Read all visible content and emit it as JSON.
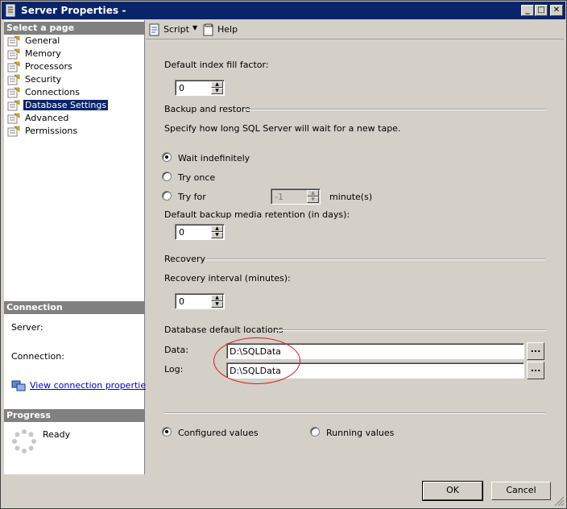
{
  "window": {
    "title": "Server Properties -"
  },
  "titlebar_buttons": {
    "minimize": "_",
    "maximize": "□",
    "close": "✕"
  },
  "left": {
    "select_page_header": "Select a page",
    "pages": [
      "General",
      "Memory",
      "Processors",
      "Security",
      "Connections",
      "Database Settings",
      "Advanced",
      "Permissions"
    ],
    "connection_header": "Connection",
    "server_label": "Server:",
    "connection_label": "Connection:",
    "view_conn_link": "View connection properties",
    "progress_header": "Progress",
    "progress_status": "Ready"
  },
  "toolbar": {
    "script": "Script",
    "help": "Help"
  },
  "settings": {
    "default_index_fill_factor_label": "Default index fill factor:",
    "default_index_fill_factor": "0",
    "backup_restore_header": "Backup and restore",
    "backup_desc": "Specify how long SQL Server will wait for a new tape.",
    "wait_indefinitely": "Wait indefinitely",
    "try_once": "Try once",
    "try_for": "Try for",
    "try_for_value": "-1",
    "minutes_unit": "minute(s)",
    "retention_label": "Default backup media retention (in days):",
    "retention_value": "0",
    "recovery_header": "Recovery",
    "recovery_interval_label": "Recovery interval (minutes):",
    "recovery_interval_value": "0",
    "db_locations_header": "Database default locations",
    "data_label": "Data:",
    "data_value": "D:\\SQLData",
    "log_label": "Log:",
    "log_value": "D:\\SQLData",
    "browse_label": "...",
    "configured_values": "Configured values",
    "running_values": "Running values"
  },
  "buttons": {
    "ok": "OK",
    "cancel": "Cancel"
  },
  "colors": {
    "titlebar": "#0a246a",
    "highlight_ellipse": "#d81b1b",
    "link": "#0000cc"
  }
}
